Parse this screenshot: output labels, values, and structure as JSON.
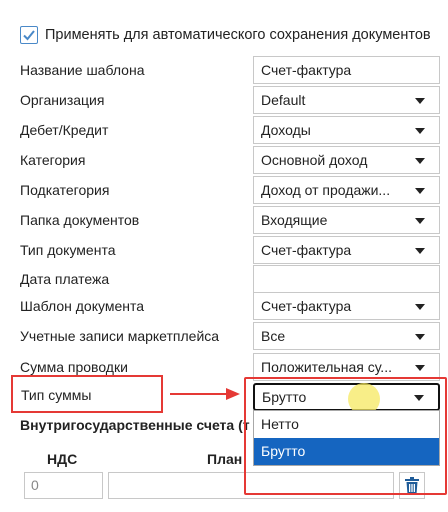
{
  "auto_save": {
    "checked": true,
    "label": "Применять для автоматического сохранения документов"
  },
  "rows": [
    {
      "label": "Название шаблона",
      "value": "Счет-фактура",
      "type": "text"
    },
    {
      "label": "Организация",
      "value": "Default",
      "type": "select"
    },
    {
      "label": "Дебет/Кредит",
      "value": "Доходы",
      "type": "select"
    },
    {
      "label": "Категория",
      "value": "Основной доход",
      "type": "select"
    },
    {
      "label": "Подкатегория",
      "value": "Доход от продажи...",
      "type": "select"
    },
    {
      "label": "Папка документов",
      "value": "Входящие",
      "type": "select"
    },
    {
      "label": "Тип документа",
      "value": "Счет-фактура",
      "type": "select"
    },
    {
      "label": "Дата платежа",
      "value": "",
      "type": "text"
    },
    {
      "label": "Шаблон документа",
      "value": "Счет-фактура",
      "type": "select"
    },
    {
      "label": "Учетные записи маркетплейса",
      "value": "Все",
      "type": "select"
    },
    {
      "label": "Сумма проводки",
      "value": "Положительная су...",
      "type": "select"
    }
  ],
  "amount_type": {
    "label": "Тип суммы",
    "value": "Брутто",
    "options": [
      {
        "label": "Нетто",
        "selected": false
      },
      {
        "label": "Брутто",
        "selected": true
      }
    ]
  },
  "domestic_accounts": {
    "title": "Внутригосударственные счета (т",
    "col_vat": "НДС",
    "col_plan": "План",
    "vat_value": "0"
  },
  "colors": {
    "highlight": "#e53935",
    "selected_option": "#1565c0",
    "checkbox_accent": "#4a89c8",
    "trash_icon": "#1f5c99"
  }
}
